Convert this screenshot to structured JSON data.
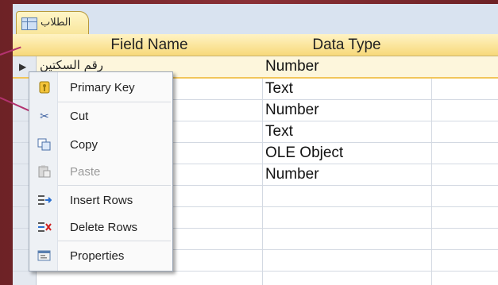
{
  "tab": {
    "label": "الطلاب"
  },
  "grid": {
    "headers": [
      "Field Name",
      "Data Type"
    ],
    "rows": [
      {
        "field_name": "رقم السكتين",
        "data_type": "Number"
      },
      {
        "field_name": "",
        "data_type": "Text"
      },
      {
        "field_name": "",
        "data_type": "Number"
      },
      {
        "field_name": "",
        "data_type": "Text"
      },
      {
        "field_name": "",
        "data_type": "OLE Object"
      },
      {
        "field_name": "",
        "data_type": "Number"
      }
    ]
  },
  "context_menu": {
    "items": [
      {
        "label": "Primary Key",
        "icon": "key-icon",
        "enabled": true
      },
      {
        "label": "Cut",
        "icon": "scissors-icon",
        "enabled": true
      },
      {
        "label": "Copy",
        "icon": "copy-icon",
        "enabled": true
      },
      {
        "label": "Paste",
        "icon": "paste-icon",
        "enabled": false
      },
      {
        "label": "Insert Rows",
        "icon": "insert-rows-icon",
        "enabled": true
      },
      {
        "label": "Delete Rows",
        "icon": "delete-rows-icon",
        "enabled": true
      },
      {
        "label": "Properties",
        "icon": "properties-icon",
        "enabled": true
      }
    ]
  },
  "colors": {
    "accent": "#f7d97a",
    "callout": "#b3326f",
    "background": "#7a2a2f"
  }
}
